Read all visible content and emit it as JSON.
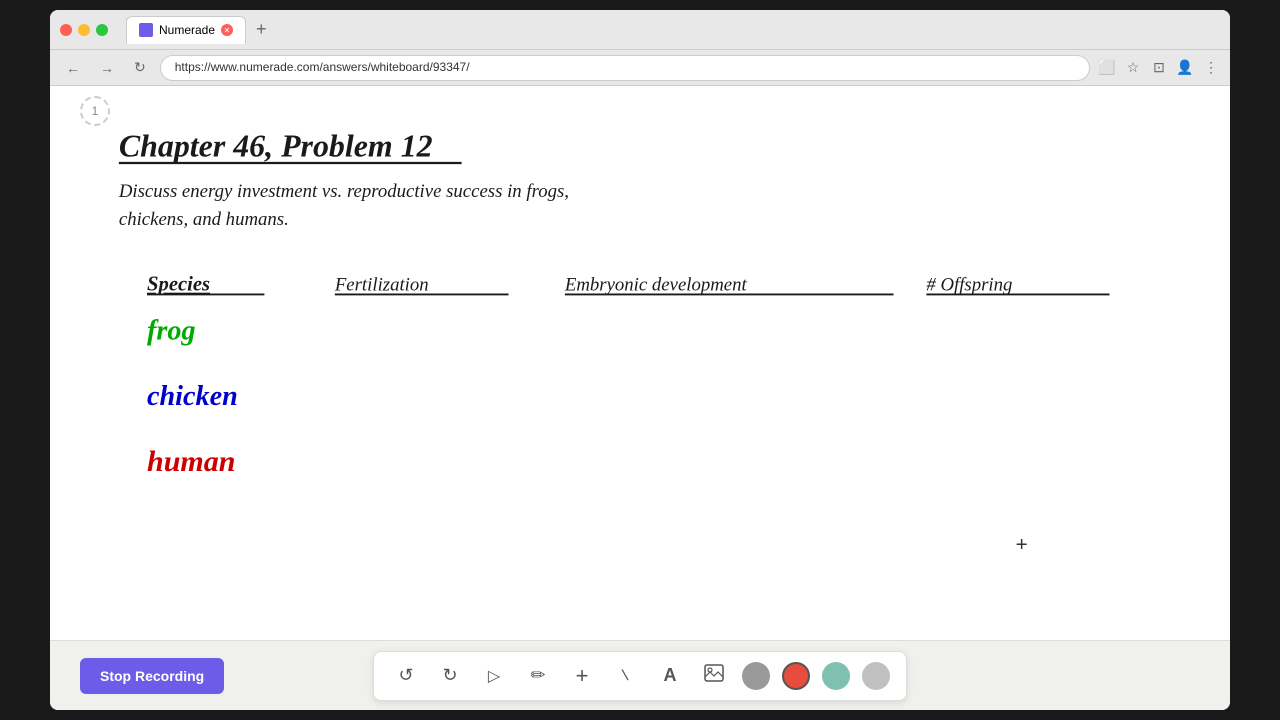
{
  "browser": {
    "title": "Numerade",
    "url": "https://www.numerade.com/answers/whiteboard/93347/",
    "tab_label": "Numerade",
    "new_tab_button": "+",
    "nav": {
      "back": "←",
      "forward": "→",
      "refresh": "↻"
    }
  },
  "toolbar_icons": {
    "screen": "⬜",
    "star": "☆",
    "window": "⬜",
    "profile": "👤",
    "menu": "⋮"
  },
  "page_number": "1",
  "whiteboard": {
    "title": "Chapter 46, Problem 12",
    "question": "Discuss energy investment vs. reproductive success in frogs,\nchickens, and humans.",
    "table": {
      "col_species": "Species",
      "col_fertilization": "Fertilization",
      "col_embryonic": "Embryonic development",
      "col_offspring": "# Offspring"
    },
    "rows": {
      "frog": "frog",
      "chicken": "chicken",
      "human": "human"
    }
  },
  "bottom_toolbar": {
    "stop_recording_label": "Stop Recording",
    "tools": {
      "undo": "↺",
      "redo": "↻",
      "select": "▷",
      "pencil": "✏",
      "plus": "+",
      "eraser": "/",
      "text": "A",
      "image": "🖼"
    },
    "colors": {
      "gray": "#999999",
      "red": "#e74c3c",
      "teal": "#80c0b0",
      "light_gray": "#c0c0c0"
    }
  },
  "cursor": {
    "plus_symbol": "+"
  }
}
